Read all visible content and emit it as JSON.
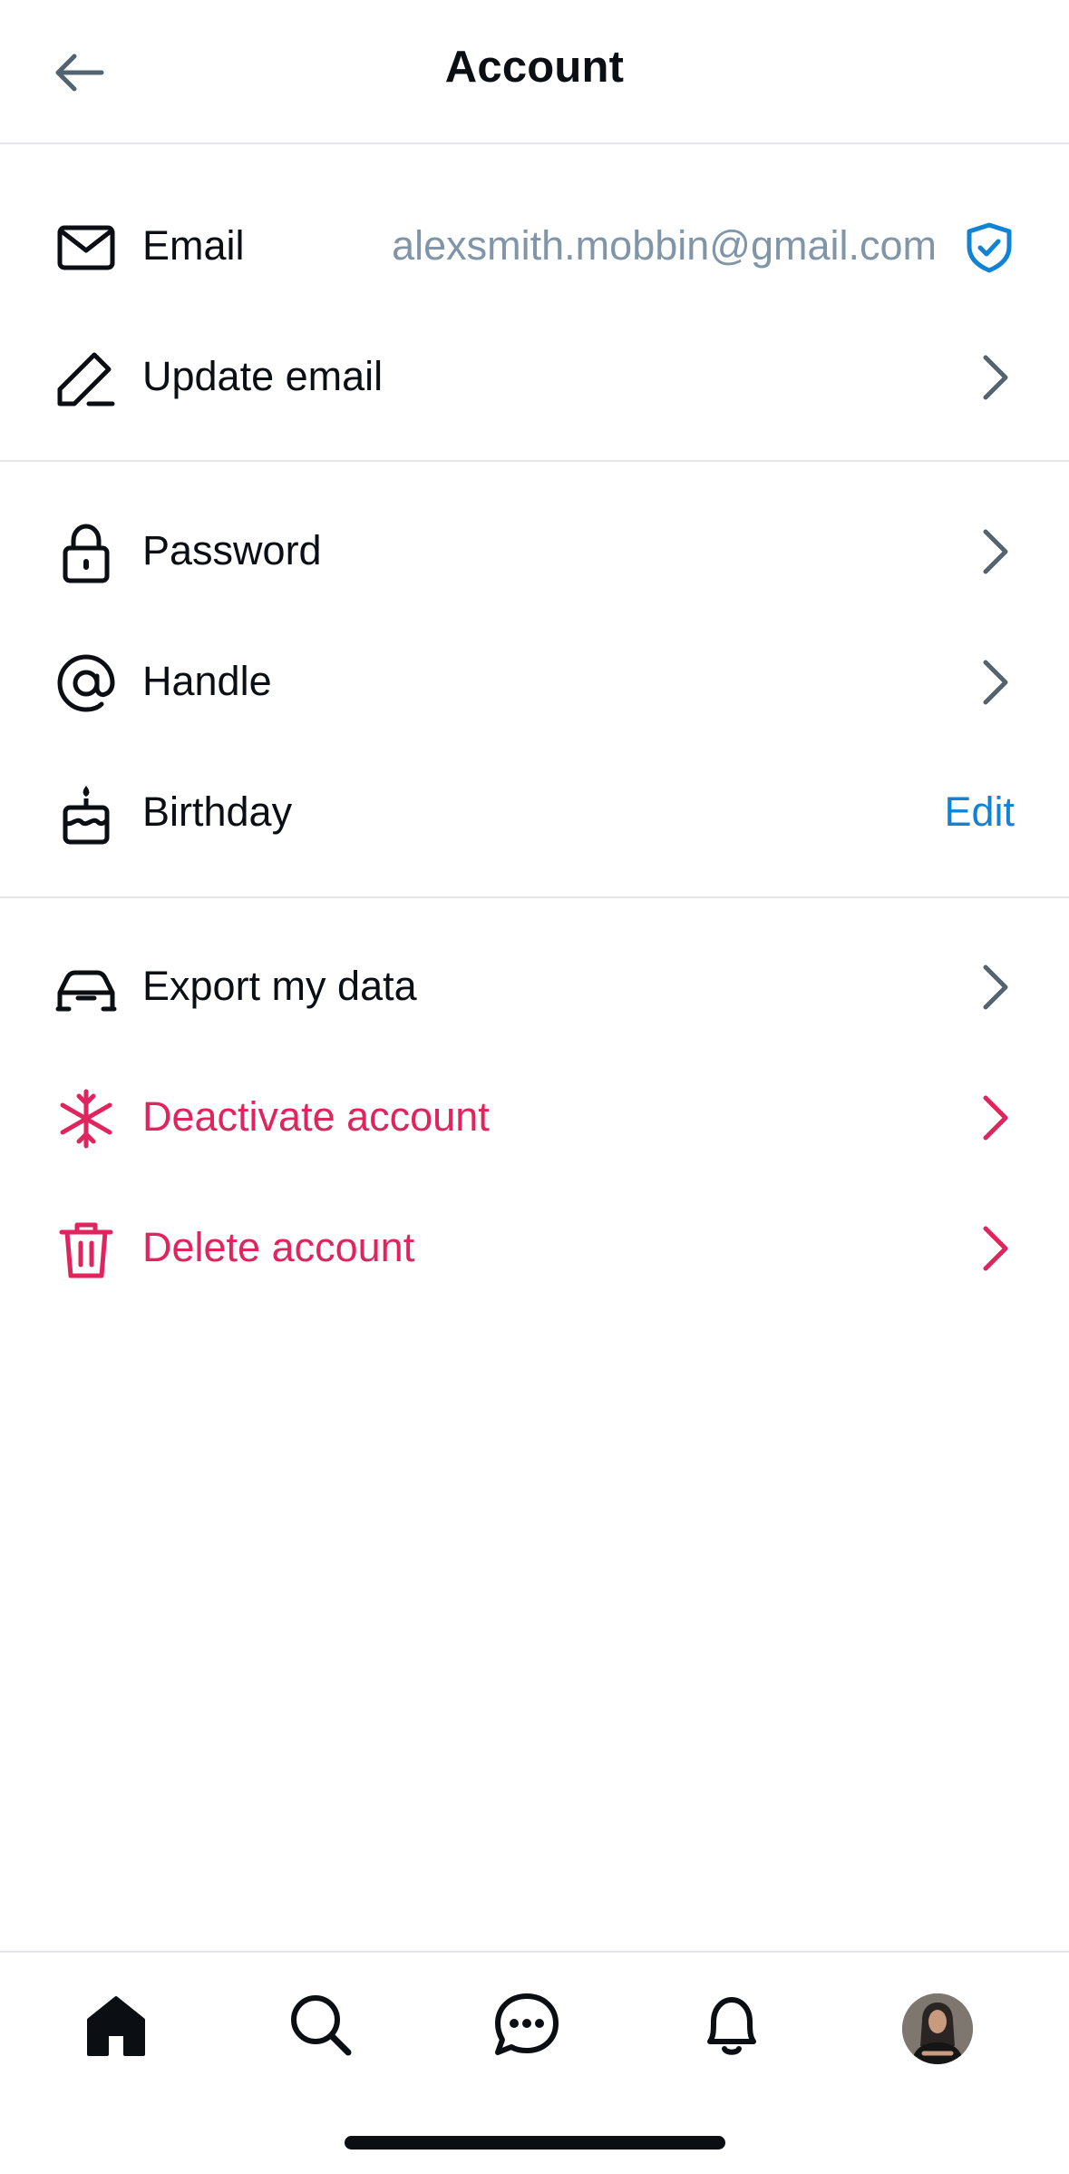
{
  "header": {
    "title": "Account"
  },
  "sections": {
    "email": {
      "email_label": "Email",
      "email_value": "alexsmith.mobbin@gmail.com",
      "update_email_label": "Update email"
    },
    "security": {
      "password_label": "Password",
      "handle_label": "Handle",
      "birthday_label": "Birthday",
      "birthday_action": "Edit"
    },
    "data": {
      "export_label": "Export my data",
      "deactivate_label": "Deactivate account",
      "delete_label": "Delete account"
    }
  },
  "icons": {
    "back": "arrow-left-icon",
    "email": "envelope-icon",
    "verified": "shield-check-icon",
    "update_email": "pencil-icon",
    "password": "lock-icon",
    "handle": "at-sign-icon",
    "birthday": "cake-icon",
    "export": "car-icon",
    "deactivate": "snowflake-icon",
    "delete": "trash-icon",
    "chevron": "chevron-right-icon"
  },
  "tabbar": {
    "tabs": [
      "home",
      "search",
      "messages",
      "notifications",
      "profile"
    ],
    "active": "home"
  },
  "colors": {
    "text": "#0b0f14",
    "secondary": "#8095a8",
    "accent": "#1083d6",
    "danger": "#e0245e",
    "divider": "#e4e6e9"
  }
}
